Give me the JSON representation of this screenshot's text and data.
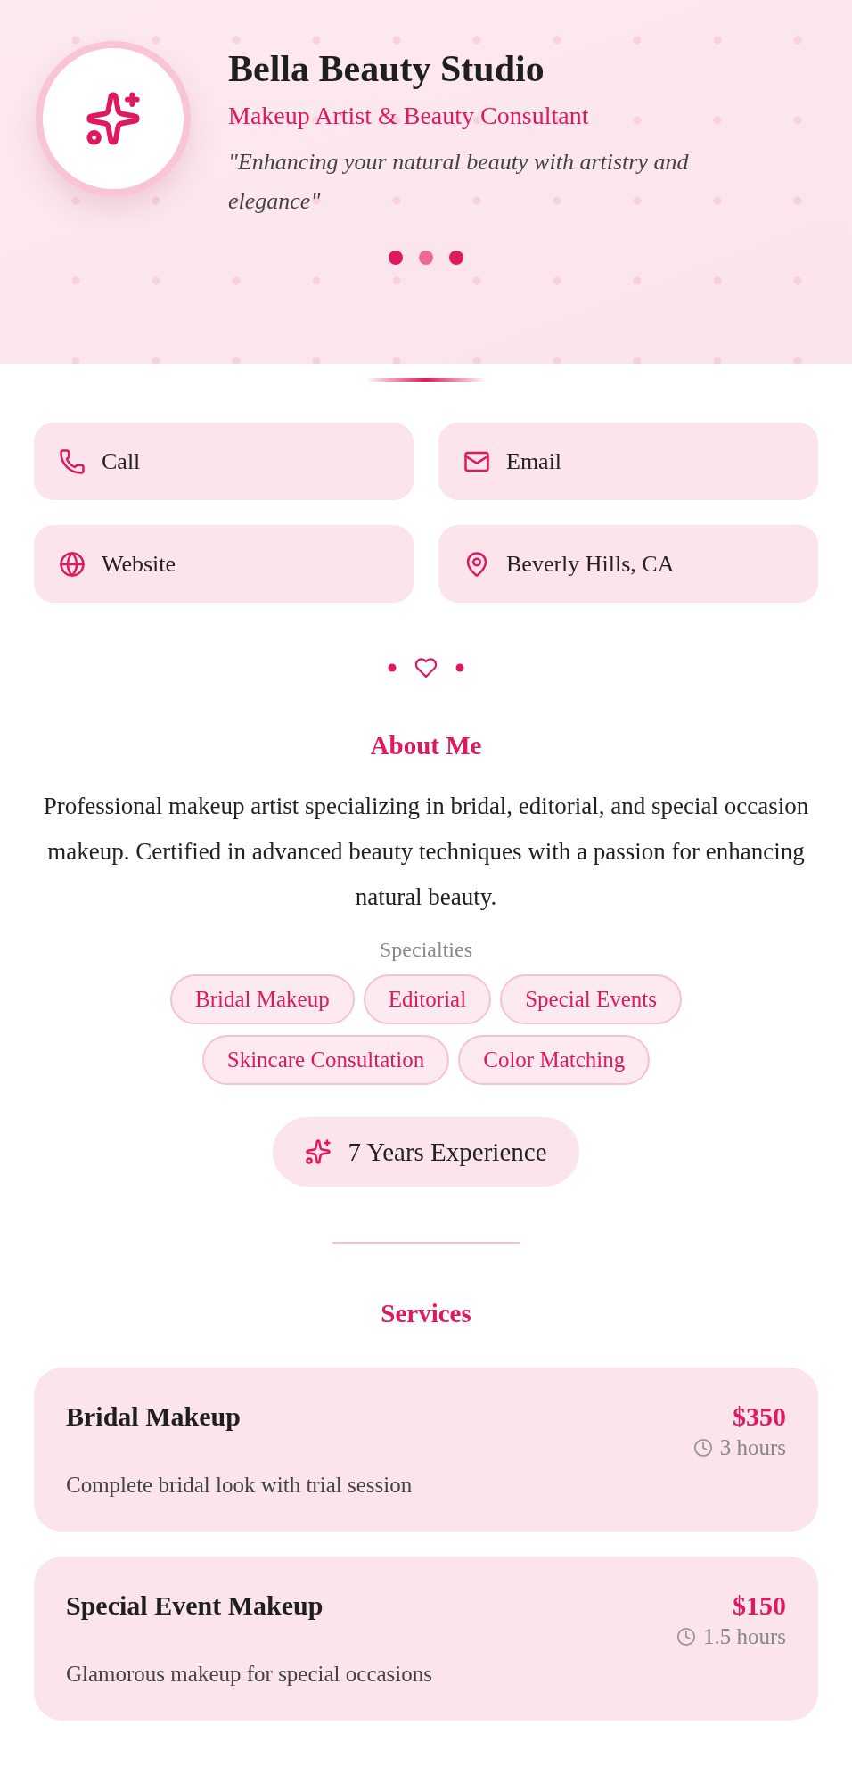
{
  "profile": {
    "name": "Bella Beauty Studio",
    "role": "Makeup Artist & Beauty Consultant",
    "tagline": "\"Enhancing your natural beauty with artistry and elegance\""
  },
  "contacts": [
    {
      "kind": "phone",
      "label": "Call"
    },
    {
      "kind": "email",
      "label": "Email"
    },
    {
      "kind": "website",
      "label": "Website"
    },
    {
      "kind": "location",
      "label": "Beverly Hills, CA"
    }
  ],
  "about": {
    "heading": "About Me",
    "text": "Professional makeup artist specializing in bridal, editorial, and special occasion makeup. Certified in advanced beauty techniques with a passion for enhancing natural beauty.",
    "specialties_label": "Specialties",
    "specialties": [
      "Bridal Makeup",
      "Editorial",
      "Special Events",
      "Skincare Consultation",
      "Color Matching"
    ],
    "experience": "7 Years Experience"
  },
  "services": {
    "heading": "Services",
    "items": [
      {
        "title": "Bridal Makeup",
        "price": "$350",
        "duration": "3 hours",
        "description": "Complete bridal look with trial session"
      },
      {
        "title": "Special Event Makeup",
        "price": "$150",
        "duration": "1.5 hours",
        "description": "Glamorous makeup for special occasions"
      }
    ]
  }
}
